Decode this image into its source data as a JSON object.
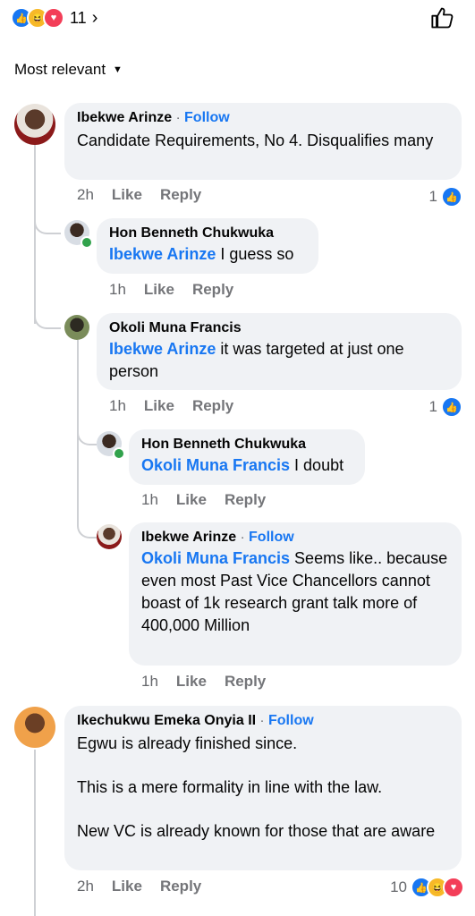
{
  "header": {
    "reaction_count": "11",
    "chevron": "›",
    "like_icon": "thumbs-up-outline",
    "sort_label": "Most relevant",
    "sort_chevron": "⌄"
  },
  "comments": [
    {
      "author": "Ibekwe Arinze",
      "follow": "Follow",
      "text": "Candidate Requirements, No 4. Disqualifies many",
      "time": "2h",
      "like": "Like",
      "reply": "Reply",
      "reactions": "1"
    },
    {
      "author": "Hon Benneth Chukwuka",
      "mention": "Ibekwe Arinze",
      "text": " I guess so",
      "time": "1h",
      "like": "Like",
      "reply": "Reply"
    },
    {
      "author": "Okoli Muna Francis",
      "mention": "Ibekwe Arinze",
      "text": " it was targeted at just one person",
      "time": "1h",
      "like": "Like",
      "reply": "Reply",
      "reactions": "1"
    },
    {
      "author": "Hon Benneth Chukwuka",
      "mention": "Okoli Muna Francis",
      "text": " I doubt",
      "time": "1h",
      "like": "Like",
      "reply": "Reply"
    },
    {
      "author": "Ibekwe Arinze",
      "follow": "Follow",
      "mention": "Okoli Muna Francis",
      "text": " Seems like.. because even most Past Vice Chancellors cannot  boast of 1k research grant talk more of 400,000 Million",
      "time": "1h",
      "like": "Like",
      "reply": "Reply"
    },
    {
      "author": "Ikechukwu Emeka Onyia II",
      "follow": "Follow",
      "text_lines": [
        "Egwu is already finished since.",
        "This is a mere formality in line with the law.",
        "New VC is already known for those that are aware"
      ],
      "time": "2h",
      "like": "Like",
      "reply": "Reply",
      "reactions": "10"
    }
  ],
  "colors": {
    "accent": "#1877f2",
    "bubble": "#f0f2f5",
    "muted": "#65676b"
  }
}
